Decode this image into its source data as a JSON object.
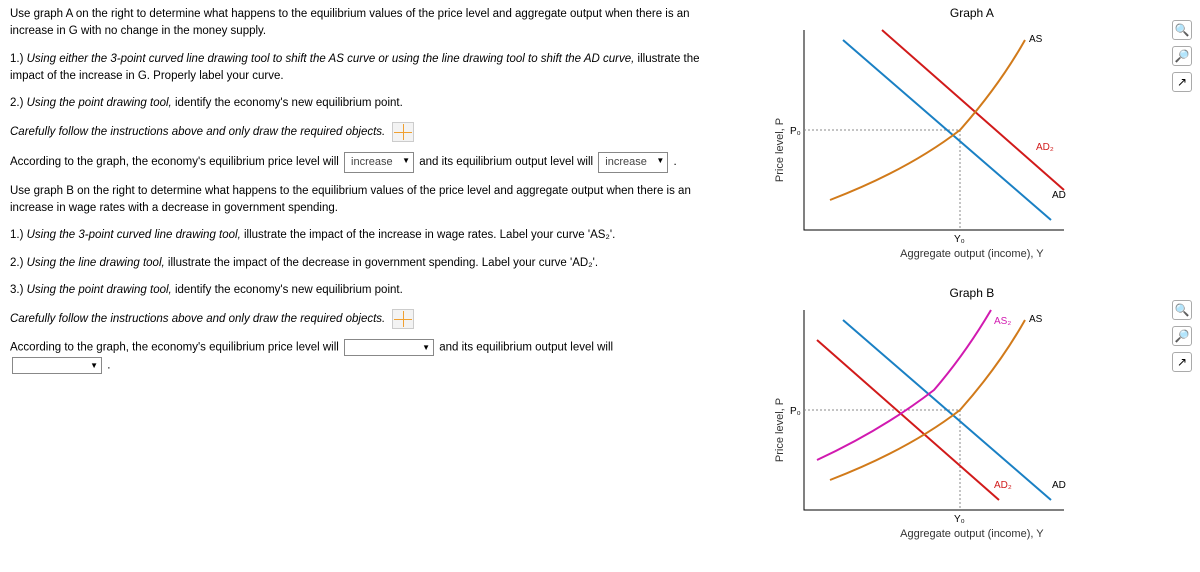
{
  "left": {
    "intro_a": "Use graph A on the right to determine what happens to the equilibrium values of the price level and aggregate output when there is an increase in G with no change in the money supply.",
    "a1_prefix": "1.) ",
    "a1_italic": "Using either the 3-point curved line drawing tool to shift the AS curve or using the line drawing tool to shift the AD curve,",
    "a1_rest": " illustrate the impact of the increase in G. Properly label your curve.",
    "a2_prefix": "2.) ",
    "a2_italic": "Using the point drawing tool,",
    "a2_rest": " identify the economy's new equilibrium point.",
    "follow": "Carefully follow the instructions above and only draw the required objects.",
    "sentence1_a": "According to the graph, the economy's equilibrium price level will ",
    "sentence1_b": " and its equilibrium output level will ",
    "ans_price_a": "increase",
    "ans_output_a": "increase",
    "period": ".",
    "intro_b": "Use graph B on the right to determine what happens to the equilibrium values of the price level and aggregate output when there is an increase in wage rates with a decrease in government spending.",
    "b1_prefix": "1.) ",
    "b1_italic": "Using the 3-point curved line drawing tool,",
    "b1_rest": " illustrate the impact of the increase in wage rates. Label your curve 'AS₂'.",
    "b2_prefix": "2.) ",
    "b2_italic": "Using the line drawing tool,",
    "b2_rest": " illustrate the impact of the decrease in government spending. Label your curve 'AD₂'.",
    "b3_prefix": "3.) ",
    "b3_italic": "Using the point drawing tool,",
    "b3_rest": " identify the economy's new equilibrium point.",
    "sentence2_a": "According to the graph, the economy's equilibrium price level will ",
    "sentence2_b": " and its equilibrium output level will "
  },
  "graphs": {
    "a_title": "Graph A",
    "b_title": "Graph B",
    "ylabel": "Price level, P",
    "xlabel": "Aggregate output (income), Y",
    "P0": "P₀",
    "Y0": "Y₀",
    "AS": "AS",
    "AD": "AD",
    "AD2": "AD₂",
    "AS2": "AS₂"
  },
  "chart_data": [
    {
      "id": "A",
      "type": "line",
      "title": "Graph A",
      "xlabel": "Aggregate output (income), Y",
      "ylabel": "Price level, P",
      "xlim": [
        0,
        100
      ],
      "ylim": [
        0,
        100
      ],
      "equilibrium": {
        "Y0": 60,
        "P0": 50
      },
      "series": [
        {
          "name": "AD",
          "color": "#1a80c4",
          "points": [
            [
              15,
              95
            ],
            [
              95,
              5
            ]
          ]
        },
        {
          "name": "AS",
          "color": "#d17a1a",
          "points": [
            [
              10,
              15
            ],
            [
              40,
              30
            ],
            [
              60,
              50
            ],
            [
              75,
              72
            ],
            [
              85,
              95
            ]
          ]
        },
        {
          "name": "AD2",
          "color": "#d11a1a",
          "points": [
            [
              30,
              100
            ],
            [
              100,
              20
            ]
          ]
        }
      ]
    },
    {
      "id": "B",
      "type": "line",
      "title": "Graph B",
      "xlabel": "Aggregate output (income), Y",
      "ylabel": "Price level, P",
      "xlim": [
        0,
        100
      ],
      "ylim": [
        0,
        100
      ],
      "equilibrium": {
        "Y0": 60,
        "P0": 50
      },
      "series": [
        {
          "name": "AD",
          "color": "#1a80c4",
          "points": [
            [
              15,
              95
            ],
            [
              95,
              5
            ]
          ]
        },
        {
          "name": "AS",
          "color": "#d17a1a",
          "points": [
            [
              10,
              15
            ],
            [
              40,
              30
            ],
            [
              60,
              50
            ],
            [
              75,
              72
            ],
            [
              85,
              95
            ]
          ]
        },
        {
          "name": "AS2",
          "color": "#d11ab0",
          "points": [
            [
              5,
              25
            ],
            [
              30,
              40
            ],
            [
              50,
              60
            ],
            [
              62,
              78
            ],
            [
              72,
              100
            ]
          ]
        },
        {
          "name": "AD2",
          "color": "#d11a1a",
          "points": [
            [
              5,
              85
            ],
            [
              75,
              5
            ]
          ]
        }
      ]
    }
  ]
}
